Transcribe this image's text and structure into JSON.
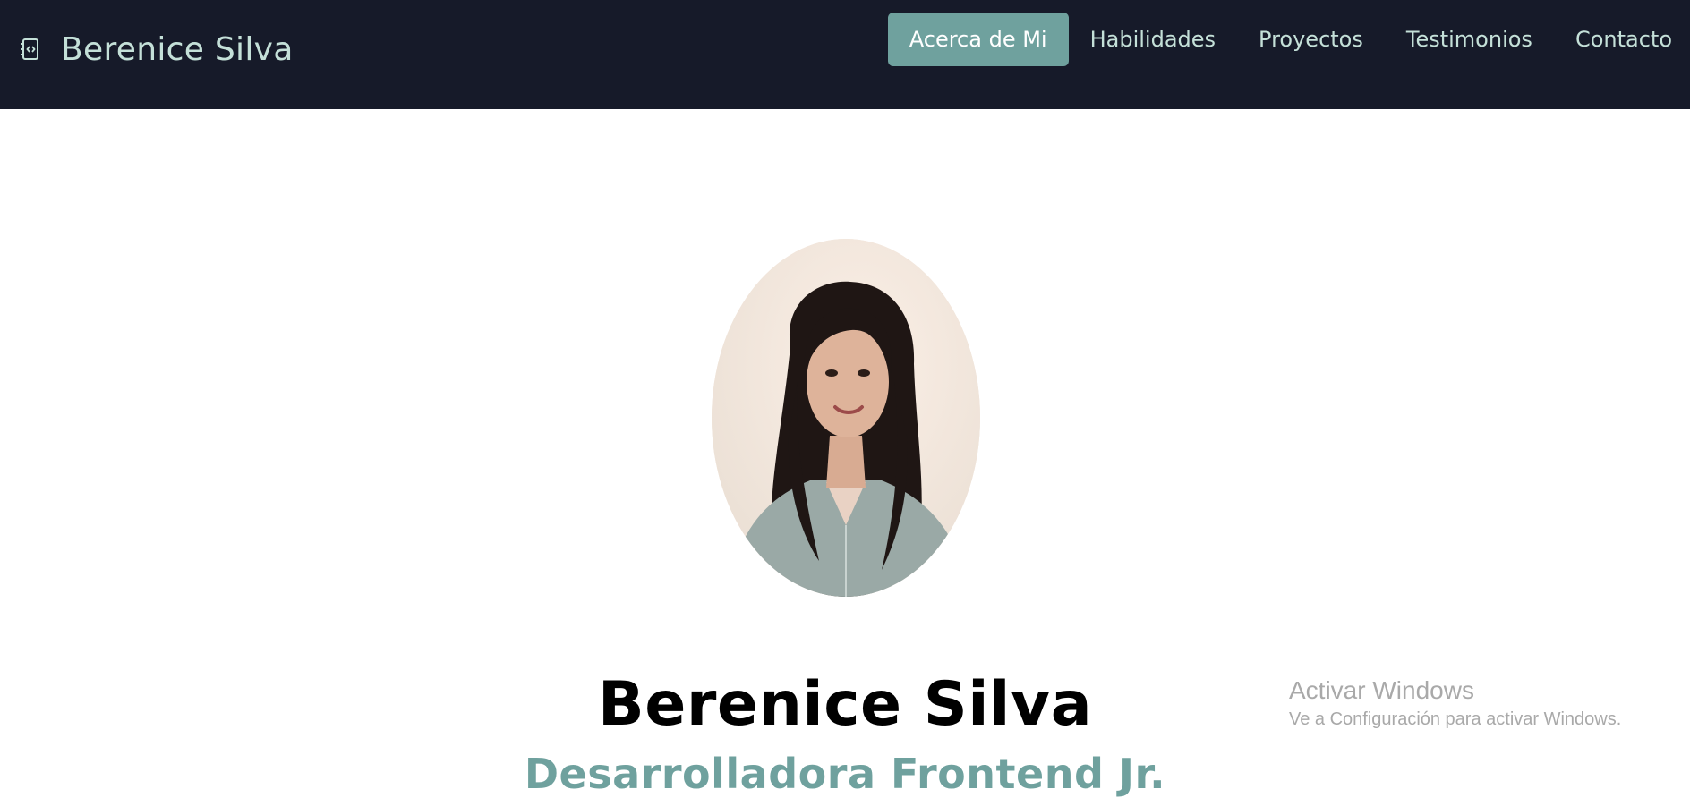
{
  "header": {
    "brand_name": "Berenice Silva",
    "brand_icon": "code-file-icon"
  },
  "nav": {
    "items": [
      {
        "label": "Acerca de Mi",
        "active": true
      },
      {
        "label": "Habilidades",
        "active": false
      },
      {
        "label": "Proyectos",
        "active": false
      },
      {
        "label": "Testimonios",
        "active": false
      },
      {
        "label": "Contacto",
        "active": false
      }
    ]
  },
  "hero": {
    "name": "Berenice Silva",
    "role": "Desarrolladora Frontend Jr."
  },
  "watermark": {
    "title": "Activar Windows",
    "subtitle": "Ve a Configuración para activar Windows."
  },
  "colors": {
    "navbar_bg": "#161a29",
    "accent": "#6fa19e",
    "nav_text": "#c4e0d8"
  }
}
